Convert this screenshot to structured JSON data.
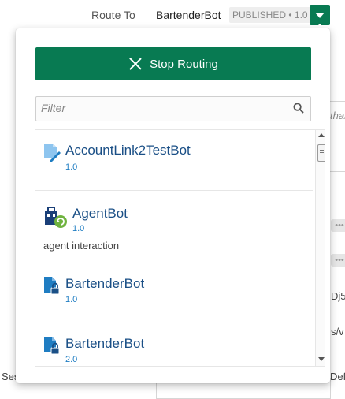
{
  "header": {
    "route_label": "Route To",
    "bot_name": "BartenderBot",
    "badge": "PUBLISHED • 1.0"
  },
  "background": {
    "frag_than": "thar",
    "frag_dj5": "Dj5",
    "frag_sv": "s/v",
    "frag_ses": "Ses",
    "frag_def": "Def"
  },
  "dropdown": {
    "stop_button": "Stop Routing",
    "filter_placeholder": "Filter",
    "items": [
      {
        "name": "AccountLink2TestBot",
        "version": "1.0",
        "icon": "document-edit-icon"
      },
      {
        "name": "AgentBot",
        "version": "1.0",
        "description": "agent interaction",
        "icon": "agent-bot-icon"
      },
      {
        "name": "BartenderBot",
        "version": "1.0",
        "icon": "locked-document-icon"
      },
      {
        "name": "BartenderBot",
        "version": "2.0",
        "icon": "locked-document-icon"
      }
    ]
  },
  "colors": {
    "primary_green": "#087a52",
    "bot_name_blue": "#1a4f86",
    "version_blue": "#1f7dc2",
    "agent_badge_green": "#6fb33f"
  }
}
